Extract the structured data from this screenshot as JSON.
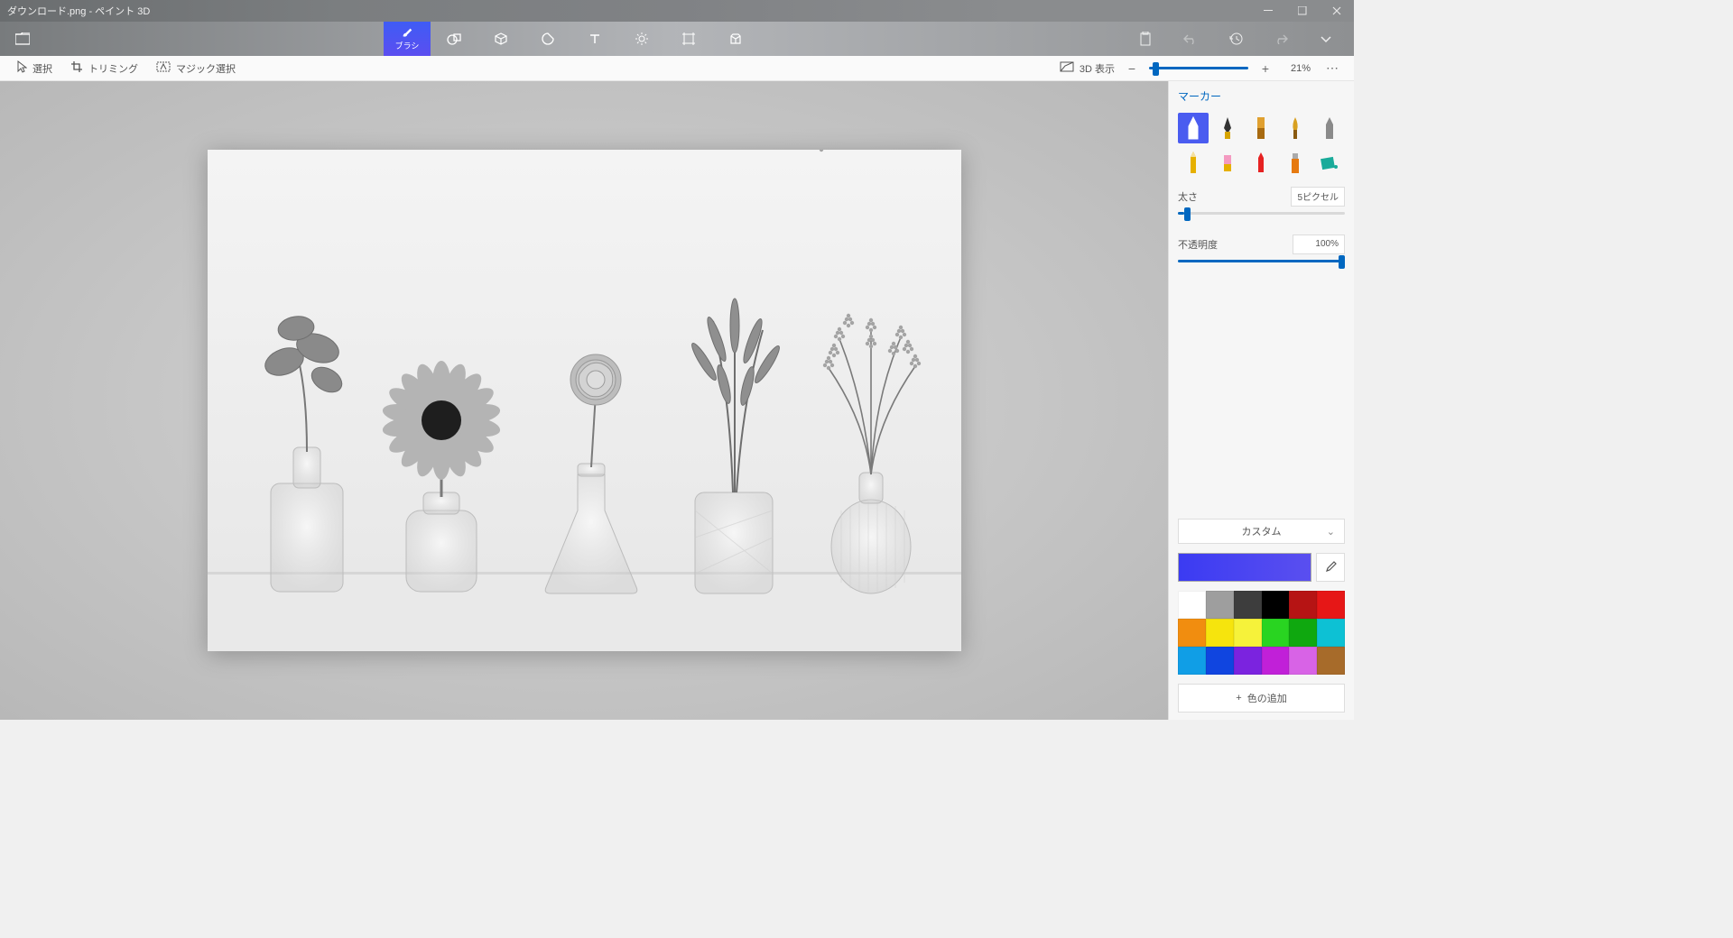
{
  "window": {
    "title": "ダウンロード.png - ペイント 3D"
  },
  "toolbar": {
    "tabs": {
      "brush": "ブラシ"
    }
  },
  "secondary": {
    "select": "選択",
    "crop": "トリミング",
    "magic": "マジック選択",
    "view3d": "3D 表示",
    "zoom_pct": "21%"
  },
  "sidebar": {
    "title": "マーカー",
    "thickness_label": "太さ",
    "thickness_value": "5ピクセル",
    "opacity_label": "不透明度",
    "opacity_value": "100%",
    "custom_label": "カスタム",
    "add_color": "色の追加",
    "palette": [
      "#ffffff",
      "#9e9e9e",
      "#3d3d3d",
      "#000000",
      "#b61414",
      "#e61717",
      "#f18d0f",
      "#f6e40d",
      "#f6f23a",
      "#29d421",
      "#0fa80f",
      "#0dc1d4",
      "#109ee6",
      "#1045e0",
      "#7b23df",
      "#c120d8",
      "#d863e6",
      "#a76b2a"
    ]
  },
  "zoom": {
    "thumb_pos_pct": 4
  },
  "thickness": {
    "pct": 4
  },
  "opacity": {
    "pct": 100
  }
}
